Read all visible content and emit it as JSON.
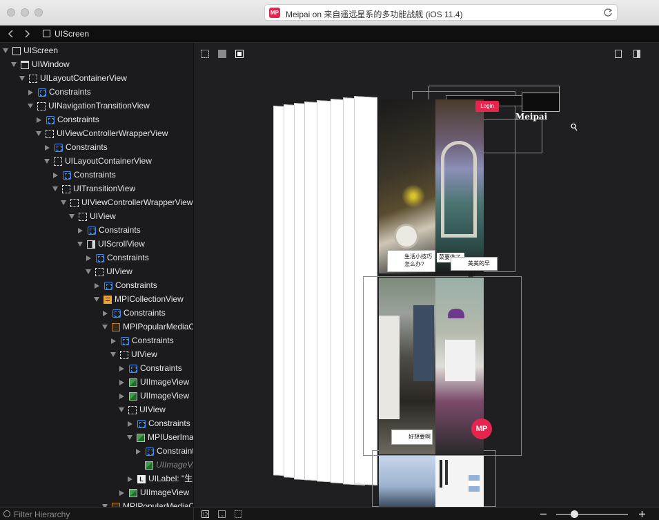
{
  "window": {
    "address_title": "Meipai on 来自遥远星系的多功能战舰 (iOS 11.4)",
    "app_badge": "MP"
  },
  "breadcrumb": {
    "label": "UIScreen"
  },
  "hierarchy": [
    {
      "label": "UIScreen",
      "icon": "screen",
      "depth": 0,
      "state": "open"
    },
    {
      "label": "UIWindow",
      "icon": "window",
      "depth": 1,
      "state": "open"
    },
    {
      "label": "UILayoutContainerView",
      "icon": "view",
      "depth": 2,
      "state": "open"
    },
    {
      "label": "Constraints",
      "icon": "constraints",
      "depth": 3,
      "state": "closed"
    },
    {
      "label": "UINavigationTransitionView",
      "icon": "view",
      "depth": 3,
      "state": "open"
    },
    {
      "label": "Constraints",
      "icon": "constraints",
      "depth": 4,
      "state": "closed"
    },
    {
      "label": "UIViewControllerWrapperView",
      "icon": "view",
      "depth": 4,
      "state": "open"
    },
    {
      "label": "Constraints",
      "icon": "constraints",
      "depth": 5,
      "state": "closed"
    },
    {
      "label": "UILayoutContainerView",
      "icon": "view",
      "depth": 5,
      "state": "open"
    },
    {
      "label": "Constraints",
      "icon": "constraints",
      "depth": 6,
      "state": "closed"
    },
    {
      "label": "UITransitionView",
      "icon": "view",
      "depth": 6,
      "state": "open"
    },
    {
      "label": "UIViewControllerWrapperView",
      "icon": "view",
      "depth": 7,
      "state": "open"
    },
    {
      "label": "UIView",
      "icon": "view",
      "depth": 8,
      "state": "open"
    },
    {
      "label": "Constraints",
      "icon": "constraints",
      "depth": 9,
      "state": "closed"
    },
    {
      "label": "UIScrollView",
      "icon": "scroll",
      "depth": 9,
      "state": "open"
    },
    {
      "label": "Constraints",
      "icon": "constraints",
      "depth": 10,
      "state": "closed"
    },
    {
      "label": "UIView",
      "icon": "view",
      "depth": 10,
      "state": "open"
    },
    {
      "label": "Constraints",
      "icon": "constraints",
      "depth": 11,
      "state": "closed"
    },
    {
      "label": "MPICollectionView",
      "icon": "collection",
      "depth": 11,
      "state": "open"
    },
    {
      "label": "Constraints",
      "icon": "constraints",
      "depth": 12,
      "state": "closed"
    },
    {
      "label": "MPIPopularMediaCe",
      "icon": "cell",
      "depth": 12,
      "state": "open"
    },
    {
      "label": "Constraints",
      "icon": "constraints",
      "depth": 13,
      "state": "closed"
    },
    {
      "label": "UIView",
      "icon": "view",
      "depth": 13,
      "state": "open"
    },
    {
      "label": "Constraints",
      "icon": "constraints",
      "depth": 14,
      "state": "closed"
    },
    {
      "label": "UIImageView",
      "icon": "image",
      "depth": 14,
      "state": "closed"
    },
    {
      "label": "UIImageView",
      "icon": "image",
      "depth": 14,
      "state": "closed"
    },
    {
      "label": "UIView",
      "icon": "view",
      "depth": 14,
      "state": "open"
    },
    {
      "label": "Constraints",
      "icon": "constraints",
      "depth": 15,
      "state": "closed"
    },
    {
      "label": "MPIUserImag",
      "icon": "image",
      "depth": 15,
      "state": "open"
    },
    {
      "label": "Constraint",
      "icon": "constraints",
      "depth": 16,
      "state": "closed"
    },
    {
      "label": "UIImageVi",
      "icon": "image",
      "depth": 16,
      "state": "none",
      "dim": true
    },
    {
      "label": "UILabel: \"生",
      "icon": "label",
      "depth": 15,
      "state": "closed"
    },
    {
      "label": "UIImageView",
      "icon": "image",
      "depth": 14,
      "state": "closed"
    },
    {
      "label": "MPIPopularMediaCe",
      "icon": "cell",
      "depth": 12,
      "state": "open"
    }
  ],
  "canvas": {
    "preview_texts": {
      "login": "Login",
      "brand": "Meipai",
      "caption1": "生活小技巧怎么办?",
      "caption2": "菜要做了",
      "caption3": "美美的早晨!",
      "caption4": "好想要啊",
      "badge": "MP"
    }
  },
  "filter": {
    "placeholder": "Filter Hierarchy"
  },
  "zoom": {
    "level": 0.25
  },
  "colors": {
    "accent": "#e6254f",
    "constraint": "#3b8ef0",
    "collection": "#e8a33a"
  }
}
